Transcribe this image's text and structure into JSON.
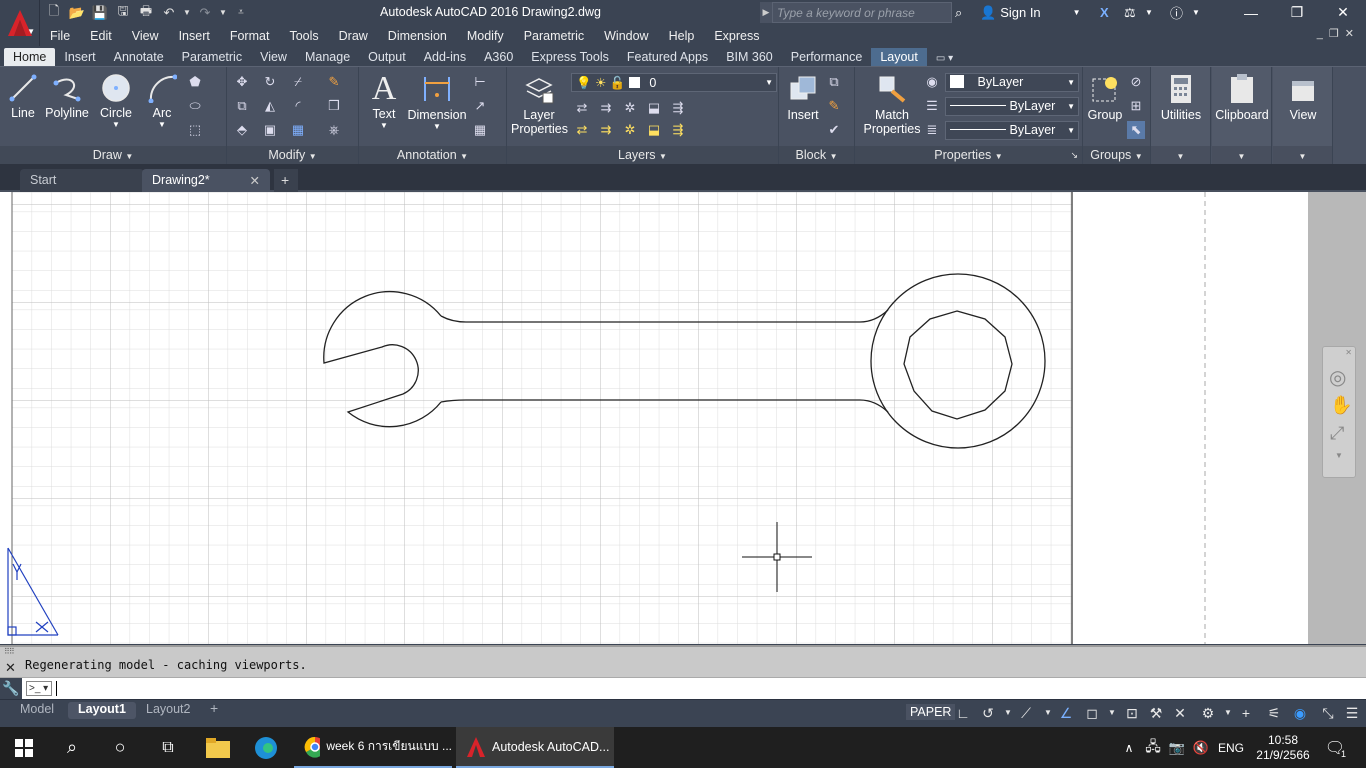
{
  "app": {
    "title": "Autodesk AutoCAD 2016    Drawing2.dwg",
    "search_placeholder": "Type a keyword or phrase",
    "sign_in": "Sign In",
    "logo_letter": "A"
  },
  "menu": [
    "File",
    "Edit",
    "View",
    "Insert",
    "Format",
    "Tools",
    "Draw",
    "Dimension",
    "Modify",
    "Parametric",
    "Window",
    "Help",
    "Express"
  ],
  "ribbon_tabs": [
    "Home",
    "Insert",
    "Annotate",
    "Parametric",
    "View",
    "Manage",
    "Output",
    "Add-ins",
    "A360",
    "Express Tools",
    "Featured Apps",
    "BIM 360",
    "Performance",
    "Layout"
  ],
  "ribbon": {
    "draw": {
      "title": "Draw",
      "line": "Line",
      "polyline": "Polyline",
      "circle": "Circle",
      "arc": "Arc"
    },
    "modify": {
      "title": "Modify"
    },
    "annotation": {
      "title": "Annotation",
      "text": "Text",
      "dimension": "Dimension"
    },
    "layers": {
      "title": "Layers",
      "layer_properties_1": "Layer",
      "layer_properties_2": "Properties",
      "current_layer": "0"
    },
    "block": {
      "title": "Block",
      "insert": "Insert"
    },
    "properties": {
      "title": "Properties",
      "match_1": "Match",
      "match_2": "Properties",
      "color": "ByLayer",
      "linetype": "ByLayer",
      "lineweight": "ByLayer"
    },
    "groups": {
      "title": "Groups",
      "group": "Group"
    },
    "utilities": "Utilities",
    "clipboard": "Clipboard",
    "view": "View"
  },
  "file_tabs": {
    "start": "Start",
    "drawing": "Drawing2*",
    "new_tab": "+"
  },
  "command": {
    "history": "Regenerating model - caching viewports.",
    "prompt": "˃_"
  },
  "layout_tabs": [
    "Model",
    "Layout1",
    "Layout2"
  ],
  "status": {
    "space": "PAPER"
  },
  "taskbar": {
    "chrome": "week 6 การเขียนแบบ ...",
    "autocad": "Autodesk AutoCAD...",
    "lang": "ENG",
    "time": "10:58",
    "date": "21/9/2566",
    "notifications": "1"
  }
}
